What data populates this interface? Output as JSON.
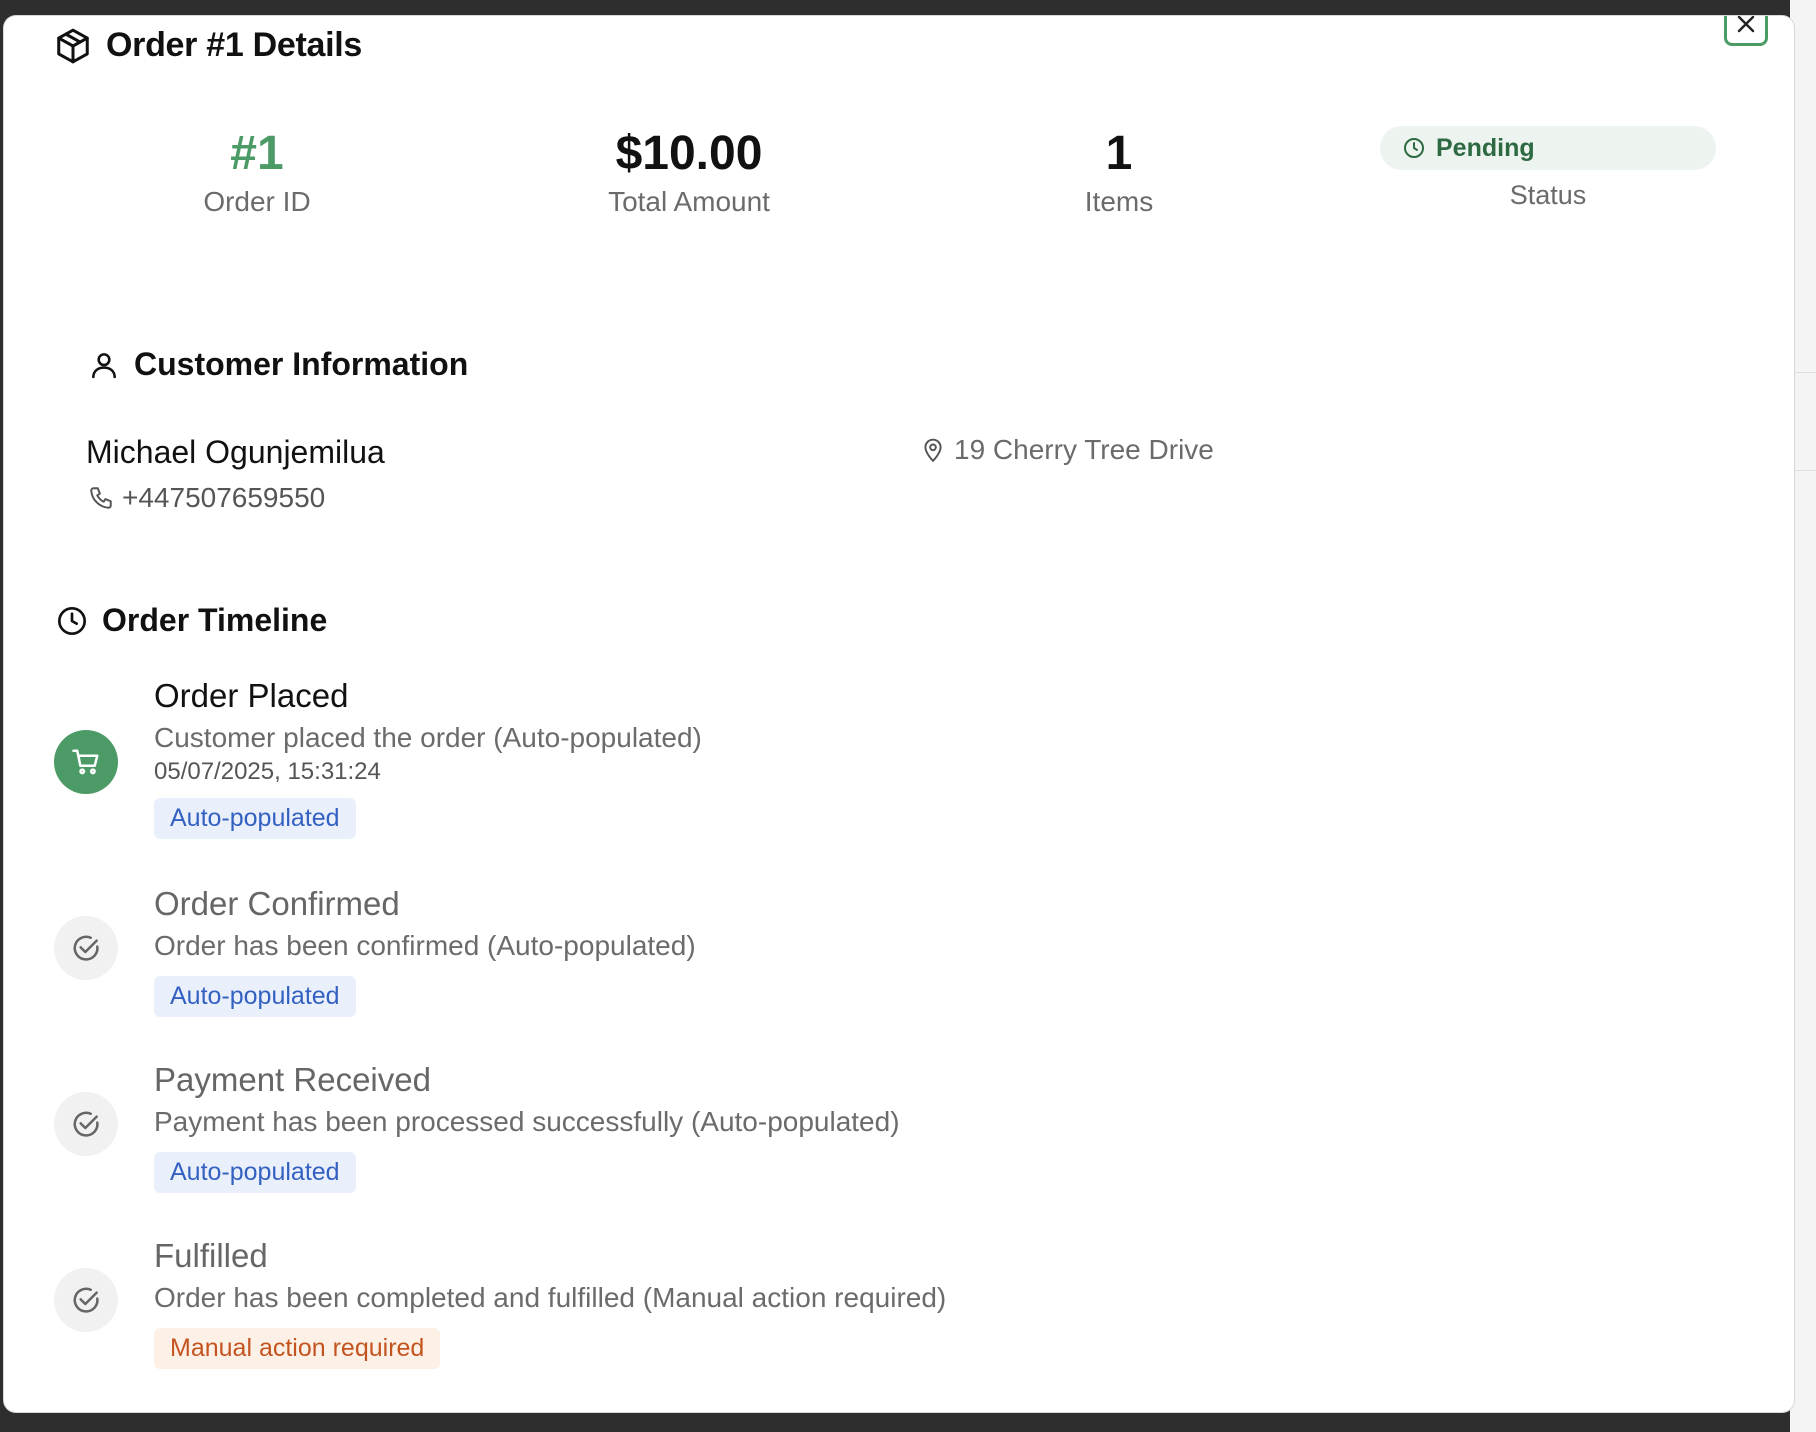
{
  "modal": {
    "title": "Order #1 Details",
    "close_label": "×"
  },
  "stats": {
    "order_id": {
      "value": "#1",
      "label": "Order ID"
    },
    "total": {
      "value": "$10.00",
      "label": "Total Amount"
    },
    "items": {
      "value": "1",
      "label": "Items"
    },
    "status": {
      "value": "Pending",
      "label": "Status"
    }
  },
  "customer": {
    "heading": "Customer Information",
    "name": "Michael Ogunjemilua",
    "phone": "+447507659550",
    "address": "19 Cherry Tree Drive"
  },
  "timeline": {
    "heading": "Order Timeline",
    "events": [
      {
        "title": "Order Placed",
        "description": "Customer placed the order (Auto-populated)",
        "timestamp": "05/07/2025, 15:31:24",
        "badge": "Auto-populated",
        "icon": "cart-icon"
      },
      {
        "title": "Order Confirmed",
        "description": "Order has been confirmed (Auto-populated)",
        "badge": "Auto-populated",
        "icon": "check-circle-icon"
      },
      {
        "title": "Payment Received",
        "description": "Payment has been processed successfully (Auto-populated)",
        "badge": "Auto-populated",
        "icon": "check-circle-icon"
      },
      {
        "title": "Fulfilled",
        "description": "Order has been completed and fulfilled (Manual action required)",
        "badge": "Manual action required",
        "icon": "check-circle-icon"
      }
    ]
  },
  "colors": {
    "accent": "#4c9b67",
    "badge_auto": "#3461c1",
    "badge_manual": "#c4541f"
  }
}
